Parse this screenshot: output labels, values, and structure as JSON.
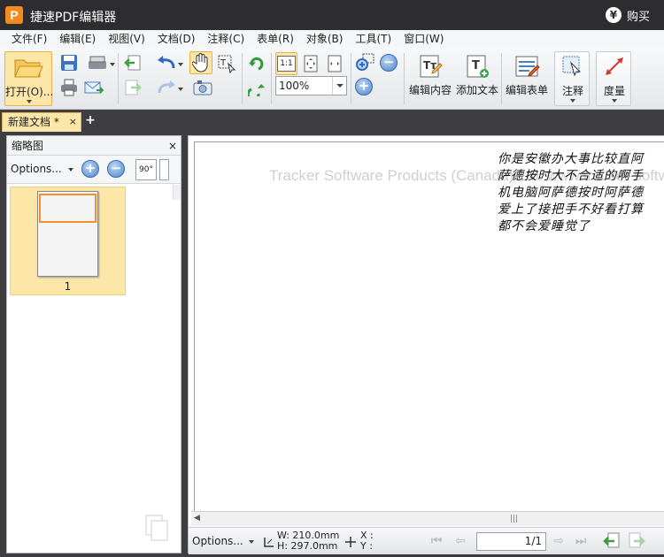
{
  "app": {
    "logo_letter": "P",
    "title": "捷速PDF编辑器",
    "buy_label": "购买",
    "buy_icon_text": "¥"
  },
  "menu": [
    "文件(F)",
    "编辑(E)",
    "视图(V)",
    "文档(D)",
    "注释(C)",
    "表单(R)",
    "对象(B)",
    "工具(T)",
    "窗口(W)"
  ],
  "toolbar": {
    "open_label": "打开(O)...",
    "zoom_value": "100%",
    "edit_content_label": "编辑内容",
    "add_text_label": "添加文本",
    "edit_form_label": "编辑表单",
    "annotate_label": "注释",
    "measure_label": "度量",
    "actual_size_text": "1:1",
    "text_tool_text": "Tт"
  },
  "tabs": {
    "doc_tab_label": "新建文档 *",
    "close": "×",
    "add": "+"
  },
  "thumbnails": {
    "title": "缩略图",
    "close": "×",
    "options_label": "Options...",
    "zoom_in": "+",
    "zoom_out": "−",
    "rotate_label": "90°",
    "pages": [
      "1"
    ]
  },
  "document": {
    "watermark": "Tracker Software Products (Canada) Ltd. www.tracker-software.com",
    "handwritten_text": "你是安徽办大事比较直阿萨德按时大不合适的啊手机电脑阿萨德按时阿萨德爱上了接把手不好看打算都不会爱睡觉了"
  },
  "statusbar": {
    "options_label": "Options...",
    "width_label": "W: 210.0mm",
    "height_label": "H: 297.0mm",
    "x_label": "X :",
    "y_label": "Y :",
    "page_indicator": "1/1"
  },
  "colors": {
    "accent": "#f38b1f",
    "selection": "#fde7a8",
    "titlebar": "#2d2d30",
    "frame": "#3e3e42"
  }
}
